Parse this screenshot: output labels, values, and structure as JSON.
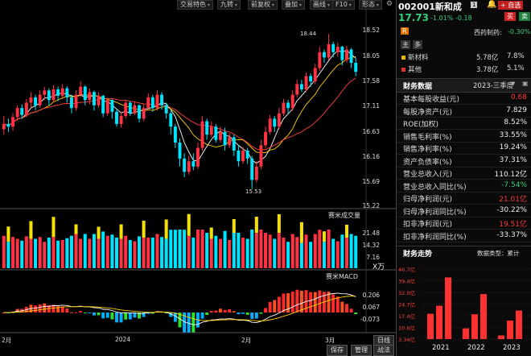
{
  "toolbar": {
    "items": [
      "交易特色",
      "九转",
      "前复权",
      "叠加",
      "画线",
      "F10",
      "形态"
    ]
  },
  "stock": {
    "code_name": "002001新和成",
    "badge": "1",
    "price": "17.73",
    "change_pct": "-1.01%",
    "change": "-0.18",
    "buy": "买",
    "sell": "卖",
    "industry_label": "西药制药:",
    "industry_change": "-0.30%",
    "watchlist": "+ 自选",
    "alert_icon": "bell-icon",
    "r_badge": "R"
  },
  "tabs": [
    "主",
    "多"
  ],
  "composition": [
    {
      "name": "新材料",
      "amount": "5.78亿",
      "pct": "7.8%",
      "color": "#e6b800"
    },
    {
      "name": "其他",
      "amount": "3.78亿",
      "pct": "5.1%",
      "color": "#e03030"
    }
  ],
  "finance": {
    "title": "财务数据",
    "period": "2023-三季度",
    "rows": [
      {
        "label": "基本每股收益(元)",
        "value": "0.68",
        "color": "red"
      },
      {
        "label": "每股净资产(元)",
        "value": "7.829",
        "color": "white"
      },
      {
        "label": "ROE(加权)",
        "value": "8.52%",
        "color": "white"
      },
      {
        "label": "销售毛利率(%)",
        "value": "33.55%",
        "color": "white"
      },
      {
        "label": "销售净利率(%)",
        "value": "19.24%",
        "color": "white"
      },
      {
        "label": "资产负债率(%)",
        "value": "37.31%",
        "color": "white"
      },
      {
        "label": "营业总收入(元)",
        "value": "110.12亿",
        "color": "white"
      },
      {
        "label": "营业总收入同比(%)",
        "value": "-7.54%",
        "color": "green"
      },
      {
        "label": "归母净利润(元)",
        "value": "21.01亿",
        "color": "red"
      },
      {
        "label": "归母净利润同比(%)",
        "value": "-30.22%",
        "color": "white"
      },
      {
        "label": "扣非净利润(元)",
        "value": "19.51亿",
        "color": "red"
      },
      {
        "label": "扣非净利润同比(%)",
        "value": "-33.37%",
        "color": "white"
      }
    ]
  },
  "trend": {
    "title": "财务走势",
    "type_label": "数据类型：累计",
    "y_ticks": [
      "46.7亿",
      "39.4亿",
      "32.0亿",
      "24.7亿",
      "17.4亿",
      "10.6亿",
      "3.34亿"
    ],
    "x_ticks": [
      "2021",
      "2022",
      "2023"
    ],
    "bars": [
      19.0,
      24.0,
      41.5,
      10.0,
      18.7,
      31.2,
      5.6,
      14.8,
      21.0
    ],
    "color": "#ff3030"
  },
  "price_axis": [
    "18.52",
    "18.05",
    "17.58",
    "17.11",
    "16.63",
    "16.16",
    "15.69",
    "15.22"
  ],
  "high_marker": "18.44",
  "low_marker": "15.53",
  "volume_panel": {
    "title": "赛米成交量",
    "ticks": [
      "21.48",
      "14.32",
      "7.16"
    ],
    "unit": "X万"
  },
  "macd_panel": {
    "title": "赛米MACD",
    "ticks": [
      "0.206",
      "0.067",
      "-0.073"
    ]
  },
  "x_axis": [
    "2月",
    "2024",
    "2月",
    "3月"
  ],
  "bottom_buttons": [
    "保存",
    "管理",
    "日线",
    "战法"
  ],
  "colors": {
    "up": "#ff3344",
    "down": "#00e5ff",
    "ma5": "#ffffff",
    "ma10": "#ffd000",
    "ma20": "#ff4040"
  },
  "candle_data": [
    [
      16.65,
      16.75,
      16.9,
      16.55
    ],
    [
      16.75,
      16.7,
      16.85,
      16.6
    ],
    [
      16.7,
      16.88,
      16.95,
      16.62
    ],
    [
      16.88,
      17.05,
      17.1,
      16.8
    ],
    [
      17.05,
      16.92,
      17.12,
      16.85
    ],
    [
      16.92,
      17.15,
      17.22,
      16.88
    ],
    [
      17.15,
      17.25,
      17.35,
      17.05
    ],
    [
      17.25,
      17.1,
      17.3,
      17.0
    ],
    [
      17.1,
      17.3,
      17.38,
      17.05
    ],
    [
      17.3,
      17.38,
      17.45,
      17.2
    ],
    [
      17.38,
      17.2,
      17.42,
      17.1
    ],
    [
      17.2,
      17.4,
      17.48,
      17.15
    ],
    [
      17.4,
      17.28,
      17.45,
      17.18
    ],
    [
      17.28,
      17.42,
      17.5,
      17.22
    ],
    [
      17.42,
      17.25,
      17.46,
      17.15
    ],
    [
      17.25,
      17.05,
      17.3,
      16.95
    ],
    [
      17.05,
      17.3,
      17.38,
      17.0
    ],
    [
      17.3,
      17.45,
      17.55,
      17.25
    ],
    [
      17.45,
      17.2,
      17.48,
      17.1
    ],
    [
      17.2,
      17.35,
      17.42,
      17.12
    ],
    [
      17.35,
      17.1,
      17.38,
      17.0
    ],
    [
      17.1,
      17.28,
      17.35,
      17.05
    ],
    [
      17.28,
      16.95,
      17.3,
      16.88
    ],
    [
      16.95,
      17.2,
      17.25,
      16.9
    ],
    [
      17.2,
      16.98,
      17.22,
      16.85
    ],
    [
      16.98,
      16.75,
      17.02,
      16.7
    ],
    [
      16.75,
      16.9,
      16.98,
      16.68
    ],
    [
      16.9,
      17.15,
      17.2,
      16.85
    ],
    [
      17.15,
      16.95,
      17.18,
      16.9
    ],
    [
      16.95,
      17.1,
      17.18,
      16.92
    ],
    [
      17.1,
      16.85,
      17.12,
      16.78
    ],
    [
      16.85,
      17.05,
      17.12,
      16.8
    ],
    [
      17.05,
      17.25,
      17.32,
      17.0
    ],
    [
      17.25,
      17.05,
      17.3,
      16.98
    ],
    [
      17.05,
      17.3,
      17.38,
      17.0
    ],
    [
      17.3,
      17.1,
      17.35,
      17.02
    ],
    [
      17.1,
      16.95,
      17.15,
      16.85
    ],
    [
      16.95,
      16.7,
      17.0,
      16.55
    ],
    [
      16.7,
      16.4,
      16.75,
      16.3
    ],
    [
      16.4,
      16.1,
      16.48,
      15.95
    ],
    [
      16.1,
      15.85,
      16.2,
      15.75
    ],
    [
      15.85,
      16.05,
      16.15,
      15.8
    ],
    [
      16.05,
      15.95,
      16.2,
      15.88
    ],
    [
      15.95,
      16.3,
      16.4,
      15.9
    ],
    [
      16.3,
      16.8,
      16.9,
      16.25
    ],
    [
      16.8,
      16.55,
      16.85,
      16.45
    ],
    [
      16.55,
      16.7,
      16.8,
      16.5
    ],
    [
      16.7,
      16.45,
      16.75,
      16.4
    ],
    [
      16.45,
      16.6,
      16.7,
      16.4
    ],
    [
      16.6,
      16.35,
      16.68,
      16.25
    ],
    [
      16.35,
      16.5,
      16.58,
      16.3
    ],
    [
      16.5,
      16.25,
      16.55,
      16.15
    ],
    [
      16.25,
      16.05,
      16.35,
      15.95
    ],
    [
      16.05,
      16.25,
      16.32,
      16.0
    ],
    [
      16.25,
      16.1,
      16.3,
      16.0
    ],
    [
      16.1,
      15.7,
      16.15,
      15.53
    ],
    [
      15.7,
      15.95,
      16.05,
      15.65
    ],
    [
      15.95,
      16.35,
      16.45,
      15.9
    ],
    [
      16.35,
      16.6,
      16.7,
      16.3
    ],
    [
      16.6,
      16.85,
      16.92,
      16.55
    ],
    [
      16.85,
      16.7,
      16.9,
      16.6
    ],
    [
      16.7,
      16.95,
      17.05,
      16.65
    ],
    [
      16.95,
      17.15,
      17.22,
      16.9
    ],
    [
      17.15,
      17.05,
      17.2,
      16.95
    ],
    [
      17.05,
      17.3,
      17.38,
      17.0
    ],
    [
      17.3,
      17.5,
      17.58,
      17.25
    ],
    [
      17.5,
      17.4,
      17.58,
      17.35
    ],
    [
      17.4,
      17.65,
      17.72,
      17.35
    ],
    [
      17.65,
      17.55,
      17.7,
      17.45
    ],
    [
      17.55,
      17.8,
      17.88,
      17.5
    ],
    [
      17.8,
      18.1,
      18.2,
      17.75
    ],
    [
      18.1,
      18.0,
      18.15,
      17.9
    ],
    [
      18.0,
      18.25,
      18.44,
      17.95
    ],
    [
      18.25,
      18.1,
      18.3,
      18.0
    ],
    [
      18.1,
      18.2,
      18.28,
      18.02
    ],
    [
      18.2,
      17.95,
      18.22,
      17.85
    ],
    [
      17.95,
      18.15,
      18.22,
      17.9
    ],
    [
      18.15,
      17.9,
      18.18,
      17.8
    ],
    [
      17.9,
      17.73,
      18.0,
      17.65
    ]
  ]
}
